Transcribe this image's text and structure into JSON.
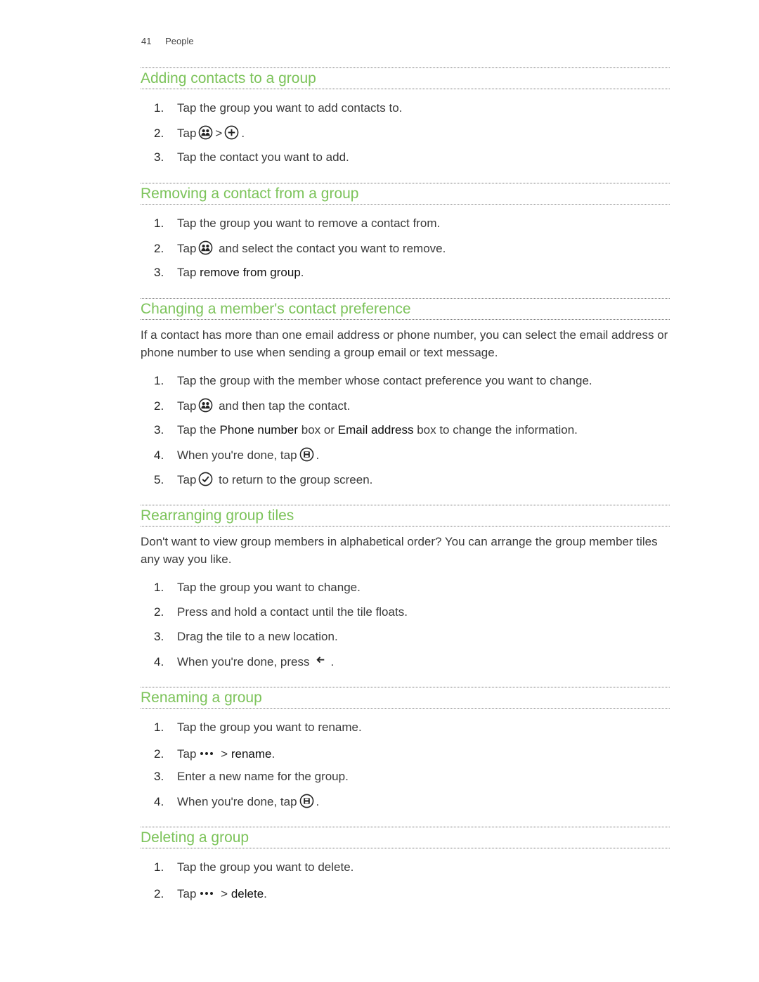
{
  "header": {
    "page_number": "41",
    "chapter": "People"
  },
  "sections": [
    {
      "title": "Adding contacts to a group",
      "steps": [
        {
          "n": "1.",
          "text": "Tap the group you want to add contacts to."
        },
        {
          "n": "2.",
          "pre": "Tap",
          "icon1": "group-icon",
          "sep": ">",
          "icon2": "plus-icon",
          "post": "."
        },
        {
          "n": "3.",
          "text": "Tap the contact you want to add."
        }
      ]
    },
    {
      "title": "Removing a contact from a group",
      "steps": [
        {
          "n": "1.",
          "text": "Tap the group you want to remove a contact from."
        },
        {
          "n": "2.",
          "pre": "Tap",
          "icon1": "group-icon",
          "post": "and select the contact you want to remove."
        },
        {
          "n": "3.",
          "pre": "Tap",
          "bold": "remove from group",
          "post": "."
        }
      ]
    },
    {
      "title": "Changing a member's contact preference",
      "intro": "If a contact has more than one email address or phone number, you can select the email address or phone number to use when sending a group email or text message.",
      "steps": [
        {
          "n": "1.",
          "text": "Tap the group with the member whose contact preference you want to change."
        },
        {
          "n": "2.",
          "pre": "Tap",
          "icon1": "group-icon",
          "post": "and then tap the contact."
        },
        {
          "n": "3.",
          "pre": "Tap the",
          "bold1": "Phone number",
          "mid": "box or",
          "bold2": "Email address",
          "post": "box to change the information."
        },
        {
          "n": "4.",
          "pre": "When you're done, tap",
          "icon1": "save-icon",
          "post": "."
        },
        {
          "n": "5.",
          "pre": "Tap",
          "icon1": "check-icon",
          "post": "to return to the group screen."
        }
      ]
    },
    {
      "title": "Rearranging group tiles",
      "intro": "Don't want to view group members in alphabetical order? You can arrange the group member tiles any way you like.",
      "steps": [
        {
          "n": "1.",
          "text": "Tap the group you want to change."
        },
        {
          "n": "2.",
          "text": "Press and hold a contact until the tile floats."
        },
        {
          "n": "3.",
          "text": "Drag the tile to a new location."
        },
        {
          "n": "4.",
          "pre": "When you're done, press",
          "icon1": "back-arrow-icon",
          "post": "."
        }
      ]
    },
    {
      "title": "Renaming a group",
      "steps": [
        {
          "n": "1.",
          "text": "Tap the group you want to rename."
        },
        {
          "n": "2.",
          "pre": "Tap",
          "icon1": "more-icon",
          "sep": ">",
          "bold": "rename",
          "post": "."
        },
        {
          "n": "3.",
          "text": "Enter a new name for the group."
        },
        {
          "n": "4.",
          "pre": "When you're done, tap",
          "icon1": "save-icon",
          "post": "."
        }
      ]
    },
    {
      "title": "Deleting a group",
      "steps": [
        {
          "n": "1.",
          "text": "Tap the group you want to delete."
        },
        {
          "n": "2.",
          "pre": "Tap",
          "icon1": "more-icon",
          "sep": ">",
          "bold": "delete",
          "post": "."
        }
      ]
    }
  ],
  "colors": {
    "heading": "#7cc35a",
    "text": "#3a3a3a"
  }
}
